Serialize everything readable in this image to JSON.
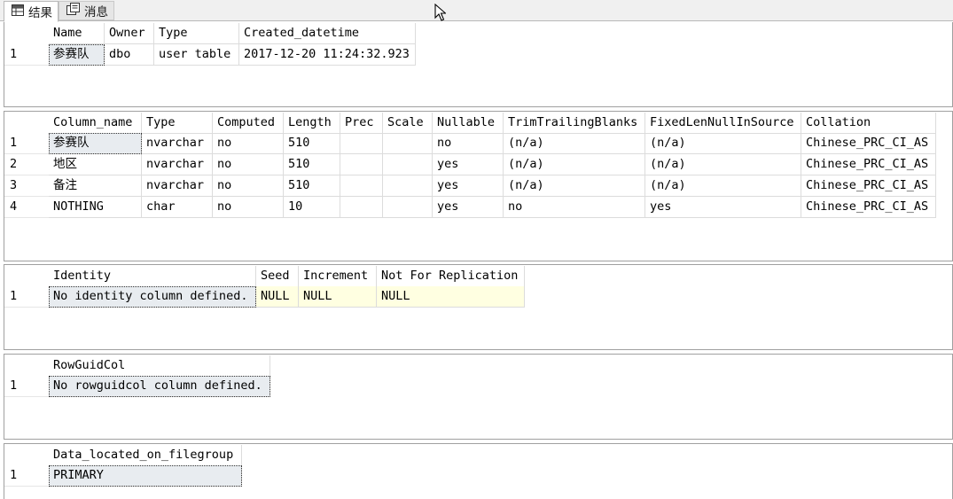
{
  "tabs": [
    {
      "label": "结果",
      "icon": "grid-icon",
      "active": true
    },
    {
      "label": "消息",
      "icon": "messages-icon",
      "active": false
    }
  ],
  "results": [
    {
      "columns": [
        "Name",
        "Owner",
        "Type",
        "Created_datetime"
      ],
      "rows": [
        {
          "num": "1",
          "cells": [
            "参赛队",
            "dbo",
            "user table",
            "2017-12-20 11:24:32.923"
          ]
        }
      ]
    },
    {
      "columns": [
        "Column_name",
        "Type",
        "Computed",
        "Length",
        "Prec",
        "Scale",
        "Nullable",
        "TrimTrailingBlanks",
        "FixedLenNullInSource",
        "Collation"
      ],
      "rows": [
        {
          "num": "1",
          "cells": [
            "参赛队",
            "nvarchar",
            "no",
            "510",
            "",
            "",
            "no",
            "(n/a)",
            "(n/a)",
            "Chinese_PRC_CI_AS"
          ]
        },
        {
          "num": "2",
          "cells": [
            "地区",
            "nvarchar",
            "no",
            "510",
            "",
            "",
            "yes",
            "(n/a)",
            "(n/a)",
            "Chinese_PRC_CI_AS"
          ]
        },
        {
          "num": "3",
          "cells": [
            "备注",
            "nvarchar",
            "no",
            "510",
            "",
            "",
            "yes",
            "(n/a)",
            "(n/a)",
            "Chinese_PRC_CI_AS"
          ]
        },
        {
          "num": "4",
          "cells": [
            "NOTHING",
            "char",
            "no",
            "10",
            "",
            "",
            "yes",
            "no",
            "yes",
            "Chinese_PRC_CI_AS"
          ]
        }
      ]
    },
    {
      "columns": [
        "Identity",
        "Seed",
        "Increment",
        "Not For Replication"
      ],
      "rows": [
        {
          "num": "1",
          "cells": [
            "No identity column defined.",
            "NULL",
            "NULL",
            "NULL"
          ]
        }
      ]
    },
    {
      "columns": [
        "RowGuidCol"
      ],
      "rows": [
        {
          "num": "1",
          "cells": [
            "No rowguidcol column defined."
          ]
        }
      ]
    },
    {
      "columns": [
        "Data_located_on_filegroup"
      ],
      "rows": [
        {
          "num": "1",
          "cells": [
            "PRIMARY"
          ]
        }
      ]
    }
  ]
}
